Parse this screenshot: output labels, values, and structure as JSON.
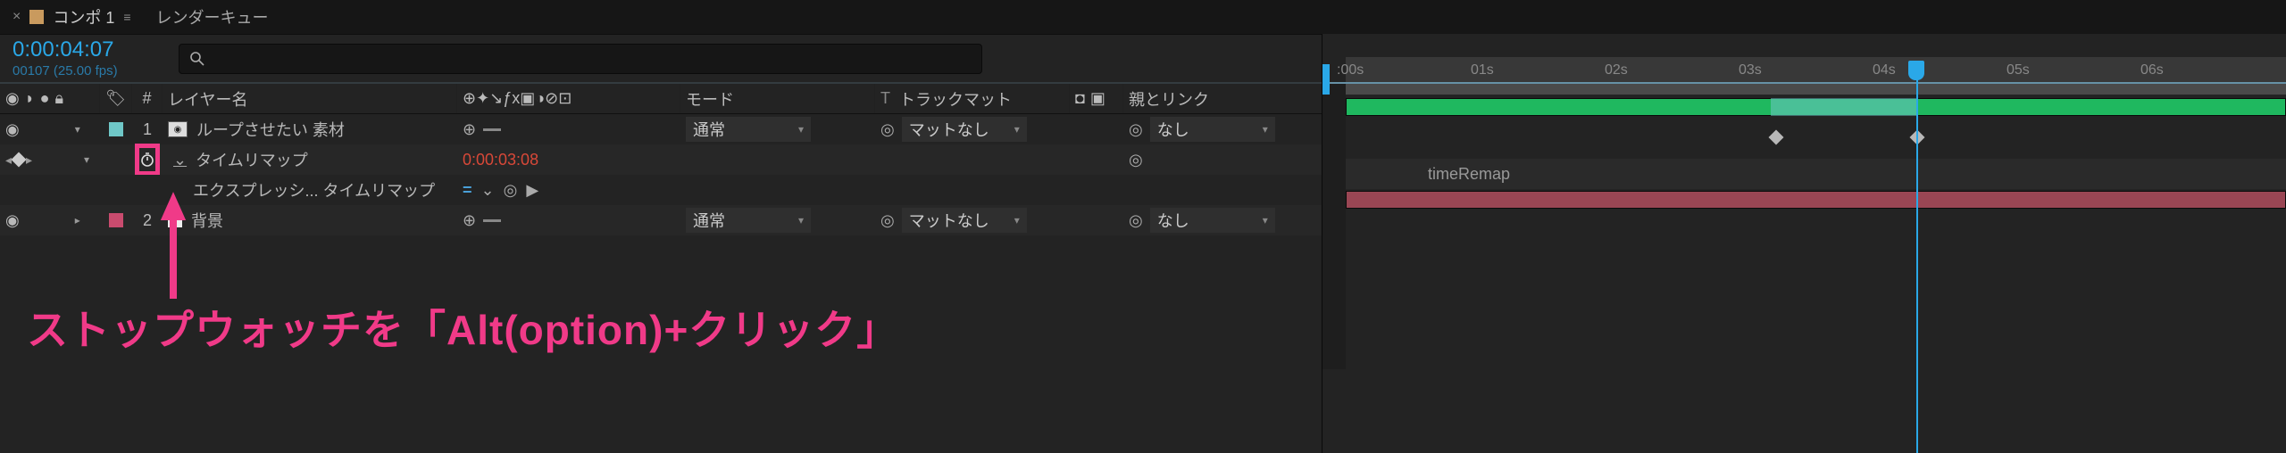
{
  "tabs": {
    "compName": "コンポ 1",
    "renderQueue": "レンダーキュー"
  },
  "timecode": {
    "main": "0:00:04:07",
    "sub": "00107 (25.00 fps)"
  },
  "search": {
    "placeholder": ""
  },
  "columns": {
    "num": "#",
    "name": "レイヤー名",
    "switches": "⊕✦↘ƒx▣◑⊘⊡",
    "mode": "モード",
    "trackT": "T",
    "track": "トラックマット",
    "parent": "親とリンク"
  },
  "layers": [
    {
      "num": "1",
      "name": "ループさせたい 素材",
      "mode": "通常",
      "track": "マットなし",
      "parent": "なし"
    },
    {
      "num": "2",
      "name": "背景",
      "mode": "通常",
      "track": "マットなし",
      "parent": "なし"
    }
  ],
  "timeRemap": {
    "label": "タイムリマップ",
    "value": "0:00:03:08"
  },
  "exprRow": {
    "label": "エクスプレッシ... タイムリマップ",
    "text": "timeRemap"
  },
  "ruler": {
    "ticks": [
      ":00s",
      "01s",
      "02s",
      "03s",
      "04s",
      "05s",
      "06s"
    ]
  },
  "annotation": "ストップウォッチを「Alt(option)+クリック」"
}
